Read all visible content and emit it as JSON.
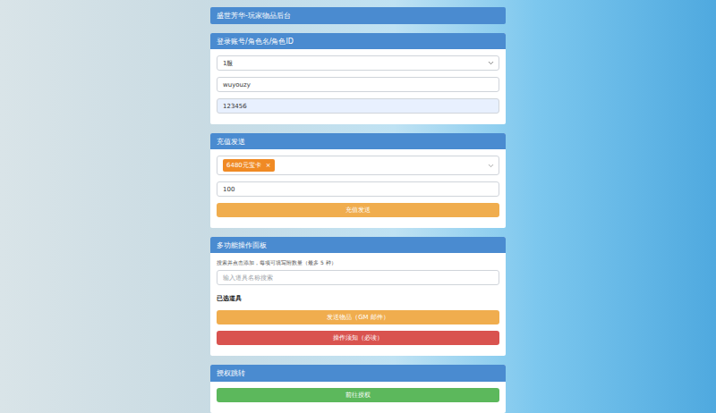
{
  "header": {
    "title": "盛世芳华-玩家物品后台"
  },
  "login": {
    "title": "登录账号/角色名/角色ID",
    "server": "1服",
    "account": "wuyouzy",
    "role": "123456",
    "role_autofilled": true
  },
  "recharge": {
    "title": "充值发送",
    "tags": [
      {
        "label": "6480元宝卡",
        "remove": "×"
      }
    ],
    "amount": "100",
    "button": {
      "label": "充值发送",
      "color": "#f0ad4e"
    }
  },
  "panel": {
    "title": "多功能操作面板",
    "hint": "搜索并点击添加，每项可填写附数量（最多 5 种）",
    "search": {
      "placeholder": "输入道具名称搜索"
    },
    "selected_label": "已选道具",
    "buttons": [
      {
        "label": "发送物品（GM 邮件）",
        "color": "#f0ad4e"
      },
      {
        "label": "操作须知（必读）",
        "color": "#d9534f"
      }
    ]
  },
  "auth": {
    "title": "授权跳转",
    "button": {
      "label": "前往授权",
      "color": "#5cb85c"
    }
  }
}
